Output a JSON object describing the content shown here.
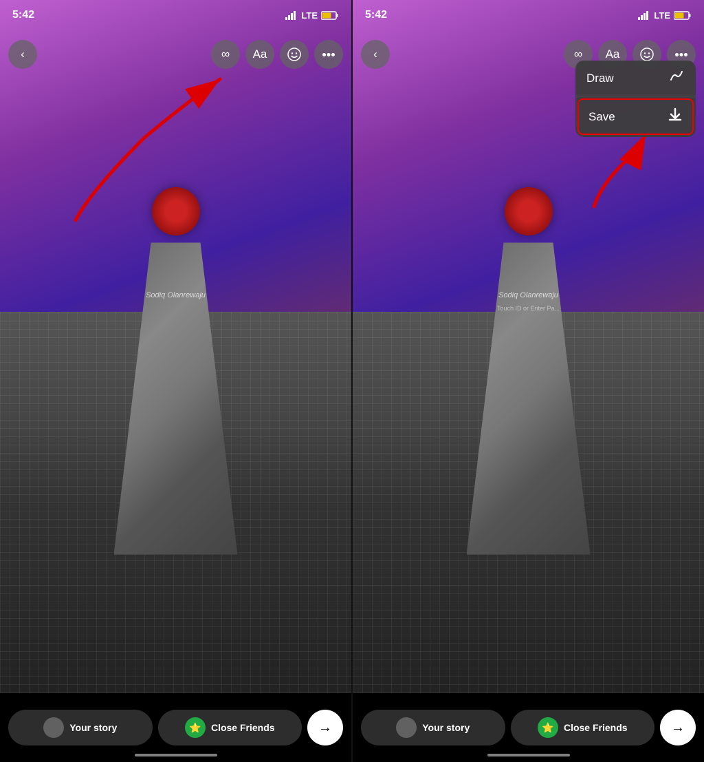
{
  "left_screen": {
    "status": {
      "time": "5:42",
      "signal": "signal",
      "lte": "LTE",
      "battery": "🔋"
    },
    "toolbar": {
      "back_label": "‹",
      "infinity_label": "∞",
      "text_label": "Aa",
      "sticker_label": "🙂",
      "more_label": "•••"
    },
    "bottom": {
      "your_story_label": "Your story",
      "close_friends_label": "Close Friends",
      "send_label": "→",
      "star_icon": "⭐"
    },
    "watermark": "Sodiq Olanrewaju"
  },
  "right_screen": {
    "status": {
      "time": "5:42",
      "signal": "signal",
      "lte": "LTE",
      "battery": "🔋"
    },
    "toolbar": {
      "back_label": "‹",
      "infinity_label": "∞",
      "text_label": "Aa",
      "sticker_label": "🙂",
      "more_label": "•••"
    },
    "dropdown": {
      "draw_label": "Draw",
      "draw_icon": "〰",
      "save_label": "Save",
      "save_icon": "⬇"
    },
    "bottom": {
      "your_story_label": "Your story",
      "close_friends_label": "Close Friends",
      "send_label": "→",
      "star_icon": "⭐"
    },
    "watermark": "Sodiq Olanrewaju",
    "watermark2": "Touch ID or Enter Pa..."
  }
}
